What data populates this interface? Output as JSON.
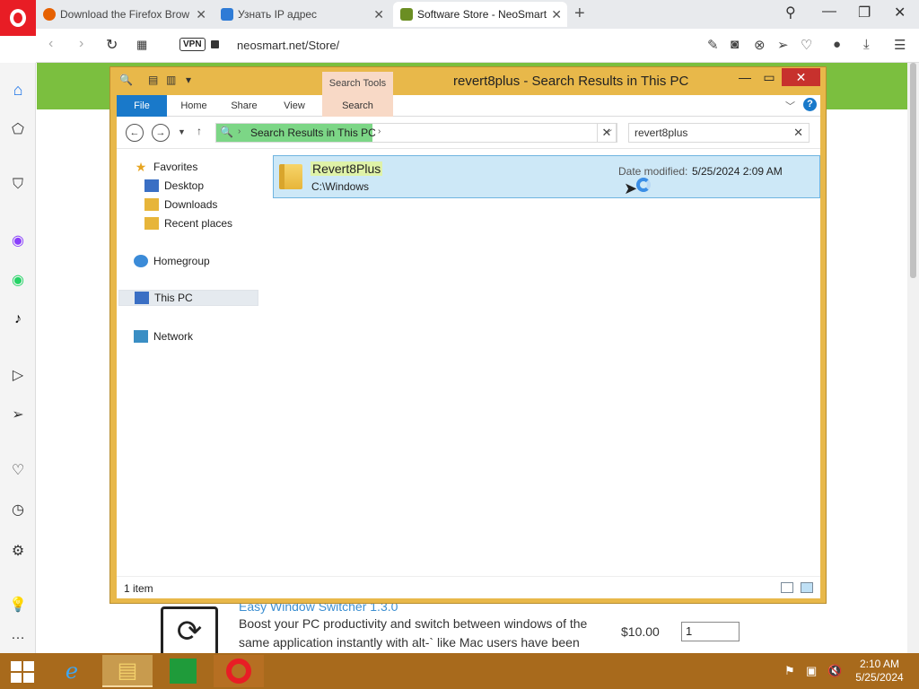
{
  "browser": {
    "tabs": [
      {
        "label": "Download the Firefox Brow",
        "color": "#e66000"
      },
      {
        "label": "Узнать IP адрес",
        "color": "#2e7bd6"
      },
      {
        "label": "Software Store - NeoSmart",
        "color": "#6b8e23"
      }
    ],
    "url": "neosmart.net/Store/",
    "vpn_label": "VPN"
  },
  "webpage": {
    "product_title": "Easy Window Switcher 1.3.0",
    "product_desc": "Boost your PC productivity and switch between windows of the same application instantly with alt-` like Mac users have been",
    "price": "$10.00",
    "qty": "1"
  },
  "explorer": {
    "title": "revert8plus - Search Results in This PC",
    "context_tab": "Search Tools",
    "ribbon_tabs": [
      "File",
      "Home",
      "Share",
      "View",
      "Search"
    ],
    "breadcrumb": "Search Results in This PC",
    "search_query": "revert8plus",
    "nav": {
      "favorites": "Favorites",
      "desktop": "Desktop",
      "downloads": "Downloads",
      "recent": "Recent places",
      "homegroup": "Homegroup",
      "thispc": "This PC",
      "network": "Network"
    },
    "result": {
      "name": "Revert8Plus",
      "path": "C:\\Windows",
      "date_label": "Date modified:",
      "date": "5/25/2024 2:09 AM"
    },
    "status": "1 item"
  },
  "taskbar": {
    "time": "2:10 AM",
    "date": "5/25/2024"
  },
  "colors": {
    "accent_orange_window": "#e8b84a",
    "taskbar": "#a86a1c",
    "opera_red": "#e81d25",
    "selection": "#cde8f7"
  }
}
